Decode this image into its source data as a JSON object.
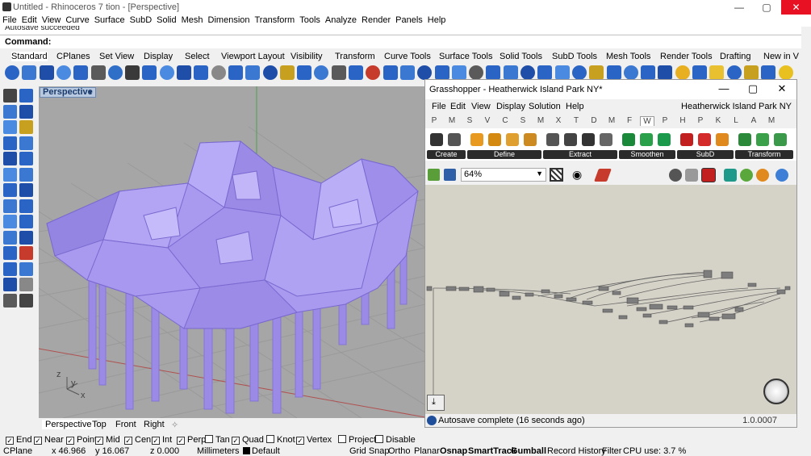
{
  "window": {
    "title": "Untitled - Rhinoceros 7 tion - [Perspective]",
    "min": "—",
    "max": "▢",
    "close": "✕"
  },
  "menu": [
    "File",
    "Edit",
    "View",
    "Curve",
    "Surface",
    "SubD",
    "Solid",
    "Mesh",
    "Dimension",
    "Transform",
    "Tools",
    "Analyze",
    "Render",
    "Panels",
    "Help"
  ],
  "command": {
    "history": "Autosave succeeded",
    "prompt": "Command:"
  },
  "tabs": [
    "Standard",
    "CPlanes",
    "Set View",
    "Display",
    "Select",
    "Viewport Layout",
    "Visibility",
    "Transform",
    "Curve Tools",
    "Surface Tools",
    "Solid Tools",
    "SubD Tools",
    "Mesh Tools",
    "Render Tools",
    "Drafting",
    "New in V"
  ],
  "active_tab": "Standard",
  "viewport": {
    "label": "Perspective",
    "tabs": [
      "Perspective",
      "Top",
      "Front",
      "Right"
    ],
    "axis_z": "z",
    "axis_y": "y",
    "axis_x": "x",
    "model_color": "#a99af0",
    "background": "#a6a6a6"
  },
  "osnap": [
    {
      "label": "End",
      "checked": true
    },
    {
      "label": "Near",
      "checked": true
    },
    {
      "label": "Point",
      "checked": true
    },
    {
      "label": "Mid",
      "checked": true
    },
    {
      "label": "Cen",
      "checked": true
    },
    {
      "label": "Int",
      "checked": true
    },
    {
      "label": "Perp",
      "checked": true
    },
    {
      "label": "Tan",
      "checked": false
    },
    {
      "label": "Quad",
      "checked": true
    },
    {
      "label": "Knot",
      "checked": false
    },
    {
      "label": "Vertex",
      "checked": true
    },
    {
      "label": "Project",
      "checked": false
    },
    {
      "label": "Disable",
      "checked": false
    }
  ],
  "status": {
    "cplane": "CPlane",
    "x": "x 46.966",
    "y": "y 16.067",
    "z": "z 0.000",
    "units": "Millimeters",
    "layer": "Default",
    "grid_snap": "Grid Snap",
    "ortho": "Ortho",
    "planar": "Planar",
    "osnap": "Osnap",
    "smarttrack": "SmartTrack",
    "gumball": "Gumball",
    "history": "Record History",
    "filter": "Filter",
    "cpu": "CPU use: 3.7 %"
  },
  "grasshopper": {
    "title": "Grasshopper - Heatherwick Island Park NY*",
    "doc_name": "Heatherwick Island Park NY",
    "menu": [
      "File",
      "Edit",
      "View",
      "Display",
      "Solution",
      "Help"
    ],
    "tabs": [
      "P",
      "M",
      "S",
      "V",
      "C",
      "S",
      "M",
      "X",
      "T",
      "D",
      "M",
      "F",
      "W",
      "P",
      "H",
      "P",
      "K",
      "L",
      "A",
      "M"
    ],
    "active_tab": "W",
    "panels": [
      "Create",
      "Define",
      "Extract",
      "Smoothen",
      "SubD",
      "Transform"
    ],
    "zoom": "64%",
    "status_message": "Autosave complete (16 seconds ago)",
    "version": "1.0.0007",
    "canvas_color": "#d5d2c7"
  }
}
